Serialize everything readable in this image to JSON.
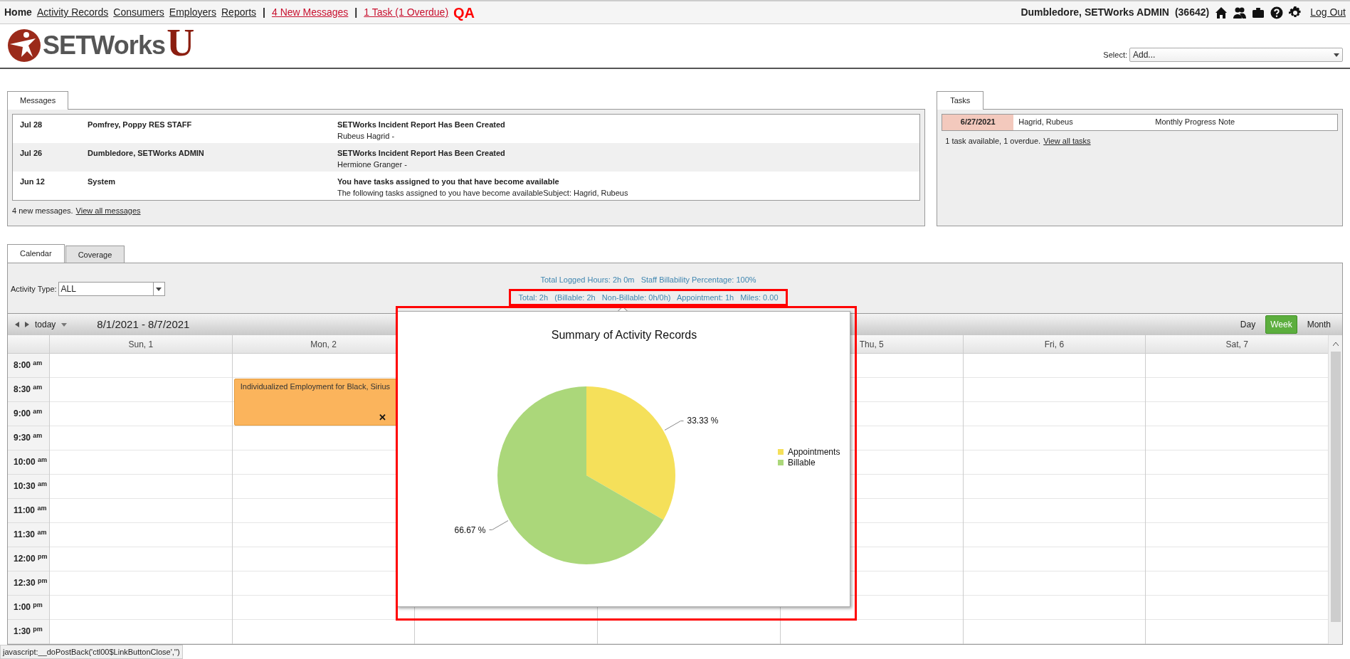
{
  "nav": {
    "links": [
      {
        "label": "Home",
        "kind": "current"
      },
      {
        "label": "Activity Records",
        "kind": "link"
      },
      {
        "label": "Consumers",
        "kind": "link"
      },
      {
        "label": "Employers",
        "kind": "link"
      },
      {
        "label": "Reports",
        "kind": "link"
      },
      {
        "label": "|",
        "kind": "separator"
      },
      {
        "label": "4 New Messages",
        "kind": "alert"
      },
      {
        "label": "|",
        "kind": "separator"
      },
      {
        "label": "1 Task (1 Overdue)",
        "kind": "alert"
      },
      {
        "label": "QA",
        "kind": "badge"
      }
    ],
    "user": "Dumbledore, SETWorks ADMIN",
    "user_id": "(36642)",
    "logout": "Log Out"
  },
  "logo": {
    "text": "SETWorks",
    "mark": "U"
  },
  "select": {
    "label": "Select:",
    "value": "Add..."
  },
  "messages": {
    "tab": "Messages",
    "rows": [
      {
        "date": "Jul 28",
        "from": "Pomfrey, Poppy RES STAFF",
        "subject": "SETWorks Incident Report Has Been Created",
        "body": "Rubeus Hagrid -"
      },
      {
        "date": "Jul 26",
        "from": "Dumbledore, SETWorks ADMIN",
        "subject": "SETWorks Incident Report Has Been Created",
        "body": "Hermione Granger -"
      },
      {
        "date": "Jun 12",
        "from": "System",
        "subject": "You have tasks assigned to you that have become available",
        "body": "The following tasks assigned to you have become availableSubject: Hagrid, Rubeus"
      }
    ],
    "summary": "4 new messages.",
    "link": "View all messages"
  },
  "tasks": {
    "tab": "Tasks",
    "rows": [
      {
        "date": "6/27/2021",
        "overdue": true,
        "person": "Hagrid, Rubeus",
        "type": "Monthly Progress Note"
      }
    ],
    "summary": "1 task available, 1 overdue.",
    "link": "View all tasks"
  },
  "calendar": {
    "tabs": [
      {
        "label": "Calendar",
        "selected": true
      },
      {
        "label": "Coverage",
        "selected": false
      }
    ],
    "activity_type": {
      "label": "Activity Type:",
      "value": "ALL"
    },
    "totals": [
      {
        "text": "Total Logged Hours: 2h 0m   Staff Billability Percentage: 100%",
        "highlighted": false
      },
      {
        "text": "Total: 2h   (Billable: 2h   Non-Billable: 0h/0h)   Appointment: 1h   Miles: 0.00",
        "highlighted": true
      }
    ],
    "today": "today",
    "range": "8/1/2021 - 8/7/2021",
    "views": [
      {
        "label": "Day",
        "selected": false
      },
      {
        "label": "Week",
        "selected": true
      },
      {
        "label": "Month",
        "selected": false
      }
    ],
    "days": [
      {
        "label": "Sun, 1"
      },
      {
        "label": "Mon, 2",
        "events": [
          {
            "title": "Individualized Employment for Black, Sirius",
            "close": "✕"
          }
        ]
      },
      {
        "covered": true
      },
      {
        "covered": true
      },
      {
        "label": "Thu, 5"
      },
      {
        "label": "Fri, 6"
      },
      {
        "label": "Sat, 7"
      }
    ],
    "times": [
      "8:00 $^{am}$",
      "8:30 $^{am}$",
      "9:00 $^{am}$",
      "9:30 $^{am}$",
      "10:00 $^{am}$",
      "10:30 $^{am}$",
      "11:00 $^{am}$",
      "11:30 $^{am}$",
      "12:00 $^{pm}$",
      "12:30 $^{pm}$",
      "1:00 $^{pm}$",
      "1:30 $^{pm}$"
    ]
  },
  "popup": {
    "chart_data": {
      "type": "pie",
      "title": "Summary of Activity Records",
      "categories": [
        "Appointments",
        "Billable"
      ],
      "values": [
        33.33,
        66.67
      ],
      "colors": [
        "#f5e05a",
        "#abd77a"
      ],
      "value_labels": [
        "33.33 %",
        "66.67 %"
      ],
      "legend": true
    }
  },
  "status_bar": "javascript:__doPostBack('ctl00$LinkButtonClose','')"
}
